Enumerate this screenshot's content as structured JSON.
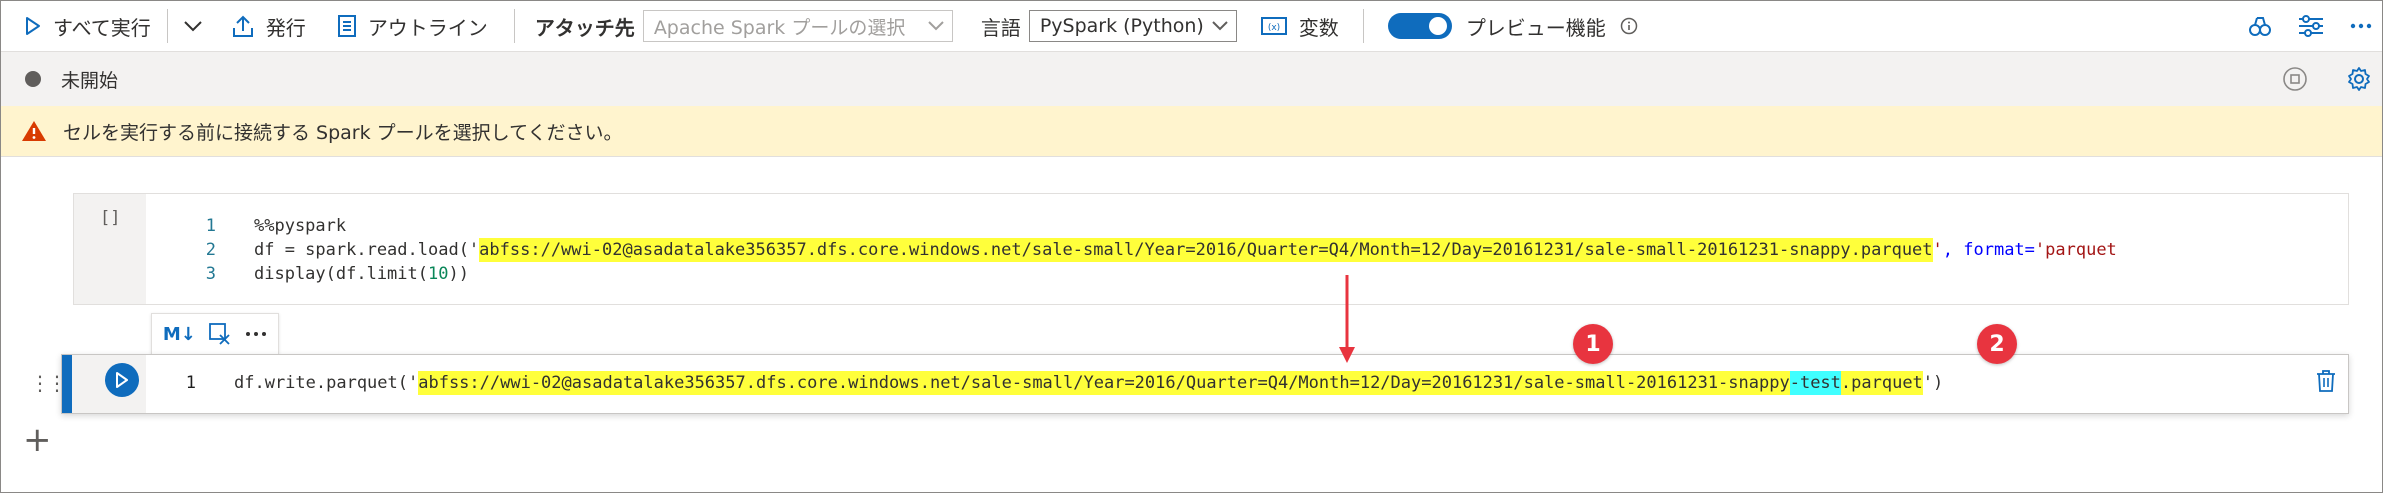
{
  "toolbar": {
    "run_all": "すべて実行",
    "publish": "発行",
    "outline": "アウトライン",
    "attach_to_label": "アタッチ先",
    "attach_to_placeholder": "Apache Spark プールの選択",
    "language_label": "言語",
    "language_value": "PySpark (Python)",
    "variables": "変数",
    "preview_features": "プレビュー機能"
  },
  "status": {
    "text": "未開始"
  },
  "warning": {
    "text": "セルを実行する前に接続する Spark プールを選択してください。"
  },
  "cell1": {
    "exec_count": "[]",
    "lines": [
      {
        "num": "1",
        "before": "%%pyspark",
        "path": "",
        "after": ""
      },
      {
        "num": "2",
        "before": "df = spark.read.load('",
        "path": "abfss://wwi-02@asadatalake356357.dfs.core.windows.net/sale-small/Year=2016/Quarter=Q4/Month=12/Day=20161231/sale-small-20161231-snappy.parquet",
        "after_str": "'",
        "after_kw": ", format=",
        "after_tail": "'parquet"
      },
      {
        "num": "3",
        "before": "display(df.limit(",
        "num_literal": "10",
        "after": "))"
      }
    ]
  },
  "cell_toolbar": {
    "md_label": "M↓"
  },
  "cell2": {
    "line_num": "1",
    "prefix": "df.write.parquet('",
    "path_part": "abfss://wwi-02@asadatalake356357.dfs.core.windows.net/sale-small/Year=2016/Quarter=Q4/Month=12/Day=20161231/sale-small-20161231-snappy",
    "highlight_part": "-test",
    "ext_part": ".parquet",
    "suffix": "')"
  },
  "annotations": {
    "badge1": "1",
    "badge2": "2"
  },
  "colors": {
    "accent": "#0f6cbd",
    "highlight_yellow": "#ffff3b",
    "highlight_cyan": "#40ffff",
    "badge_red": "#e8343f",
    "warning_bg": "#fff4ce"
  },
  "icons": [
    "play-icon",
    "chevron-down-icon",
    "publish-icon",
    "outline-icon",
    "variables-icon",
    "info-icon",
    "filter-icon",
    "settings-icon",
    "more-icon",
    "stop-icon",
    "gear-icon",
    "warning-icon",
    "markdown-icon",
    "clear-output-icon",
    "run-cell-icon",
    "trash-icon",
    "add-icon",
    "drag-handle-icon"
  ]
}
